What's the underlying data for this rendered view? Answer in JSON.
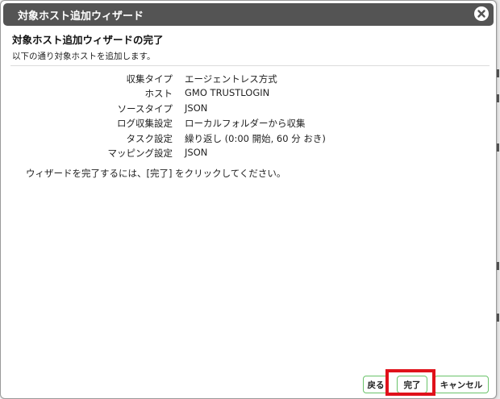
{
  "dialog": {
    "title": "対象ホスト追加ウィザード",
    "heading": "対象ホスト追加ウィザードの完了",
    "subheading": "以下の通り対象ホストを追加します。",
    "summary": [
      {
        "label": "収集タイプ",
        "value": "エージェントレス方式"
      },
      {
        "label": "ホスト",
        "value": "GMO TRUSTLOGIN"
      },
      {
        "label": "ソースタイプ",
        "value": "JSON"
      },
      {
        "label": "ログ収集設定",
        "value": "ローカルフォルダーから収集"
      },
      {
        "label": "タスク設定",
        "value": "繰り返し (0:00 開始, 60 分 おき)"
      },
      {
        "label": "マッピング設定",
        "value": "JSON"
      }
    ],
    "instruction": "ウィザードを完了するには、[完了] をクリックしてください。"
  },
  "buttons": {
    "back": "戻る",
    "finish": "完了",
    "cancel": "キャンセル"
  },
  "icons": {
    "close": "close-icon"
  },
  "colors": {
    "titlebar": "#545454",
    "button_border": "#6ac36a",
    "highlight": "#e0121b"
  }
}
